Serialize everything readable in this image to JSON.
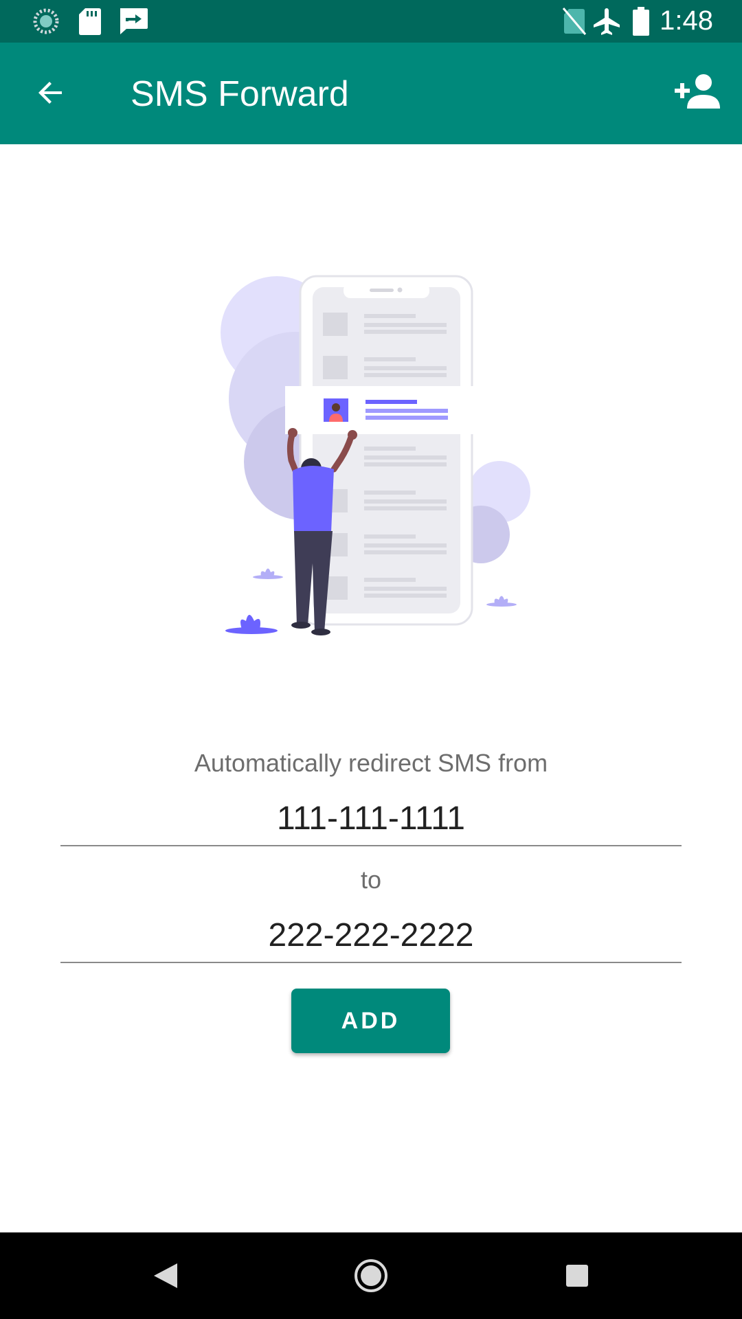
{
  "status_bar": {
    "time": "1:48",
    "icons": [
      "sync-icon",
      "sd-card-icon",
      "forward-message-icon",
      "no-sim-icon",
      "airplane-mode-icon",
      "battery-icon"
    ]
  },
  "app_bar": {
    "title": "SMS Forward",
    "back_icon": "arrow-back-icon",
    "action_icon": "add-person-icon"
  },
  "form": {
    "prompt": "Automatically redirect SMS from",
    "from_number": "111-111-1111",
    "connector": "to",
    "to_number": "222-222-2222",
    "add_button_label": "ADD"
  },
  "nav_bar": {
    "buttons": [
      "back-triangle-icon",
      "home-circle-icon",
      "recents-square-icon"
    ]
  },
  "colors": {
    "status_bar": "#00695c",
    "app_bar": "#00897b",
    "accent": "#00897b",
    "illustration_purple": "#6c63ff"
  }
}
